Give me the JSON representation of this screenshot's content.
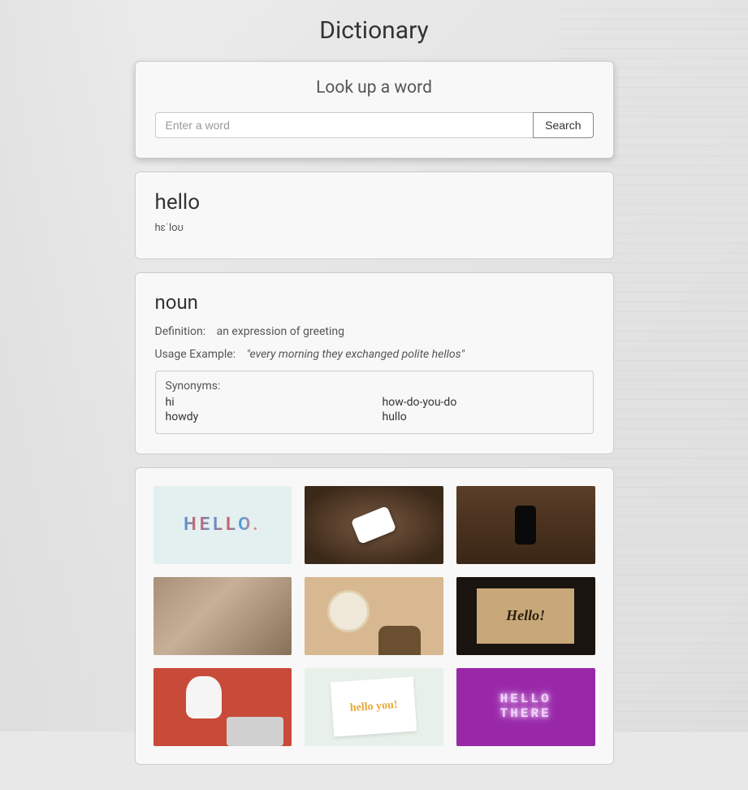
{
  "page": {
    "title": "Dictionary"
  },
  "search": {
    "title": "Look up a word",
    "placeholder": "Enter a word",
    "button_label": "Search"
  },
  "word": {
    "headword": "hello",
    "phonetic": "hɛˈloʊ"
  },
  "definition": {
    "part_of_speech": "noun",
    "definition_label": "Definition:",
    "definition_text": "an expression of greeting",
    "example_label": "Usage Example:",
    "example_text": "\"every morning they exchanged polite hellos\"",
    "synonyms_label": "Synonyms:",
    "synonyms": [
      "hi",
      "how-do-you-do",
      "howdy",
      "hullo"
    ]
  },
  "images": {
    "tiles": [
      {
        "alt": "hello-letters"
      },
      {
        "alt": "phone-on-wood"
      },
      {
        "alt": "dark-phone-wood"
      },
      {
        "alt": "handshake"
      },
      {
        "alt": "man-hat-greeting"
      },
      {
        "alt": "hello-calligraphy"
      },
      {
        "alt": "man-laptop-wave"
      },
      {
        "alt": "hello-you-card"
      },
      {
        "alt": "hello-there-neon",
        "text": "HELLO\nTHERE"
      }
    ]
  }
}
